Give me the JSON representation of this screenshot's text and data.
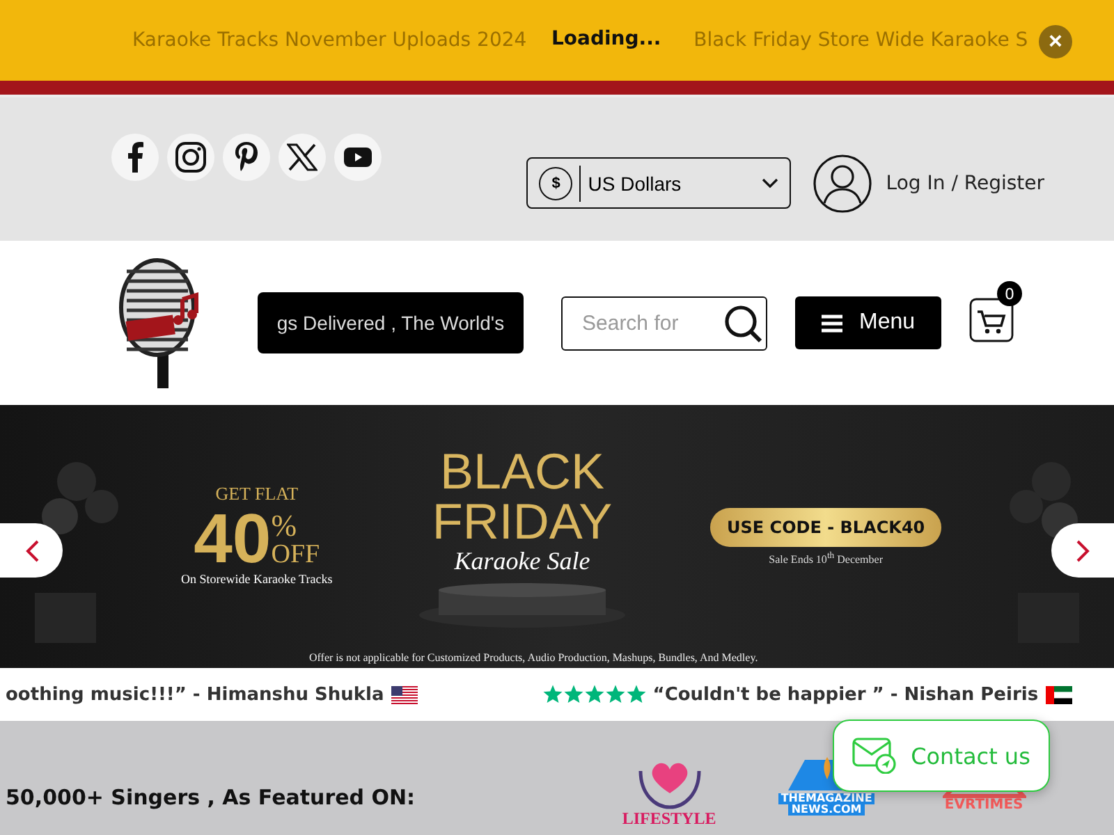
{
  "announcement_bar": {
    "items": [
      "Karaoke Tracks November Uploads 2024",
      "Black Friday Store Wide Karaoke S"
    ],
    "status": "Loading...",
    "close_label": "×"
  },
  "top_header": {
    "social_links": [
      {
        "kind": "facebook"
      },
      {
        "kind": "instagram"
      },
      {
        "kind": "pinterest"
      },
      {
        "kind": "x"
      },
      {
        "kind": "youtube"
      }
    ],
    "currency": {
      "symbol": "$",
      "value": "US Dollars"
    },
    "account_link": "Log In / Register"
  },
  "nav": {
    "tagline_marquee": "gs Delivered , The World's",
    "search": {
      "placeholder": "Search for"
    },
    "menu_button": "Menu",
    "cart_count": "0"
  },
  "banner": {
    "offer_top": "GET FLAT",
    "offer_percent": "40",
    "offer_symbol": "%",
    "offer_off": "OFF",
    "offer_note": "On Storewide Karaoke Tracks",
    "title_line_1": "BLACK",
    "title_line_2": "FRIDAY",
    "subtitle": "Karaoke Sale",
    "code": "USE CODE - BLACK40",
    "sale_ends": "Sale Ends 10$^{th}$ December",
    "disclaimer": "Offer is not applicable for Customized Products, Audio Production, Mashups, Bundles, And Medley."
  },
  "reviews": [
    {
      "text": "oothing music!!!” - Himanshu Shukla",
      "kind": "us"
    },
    {
      "text": "“Couldn't be happier ” - Nishan Peiris",
      "stars": 5,
      "kind": "ae"
    }
  ],
  "featured": {
    "heading": "50,000+ Singers , As Featured ON:",
    "logos": [
      {
        "kind": "lifestyle",
        "lines": [
          "LIFESTYLE"
        ]
      },
      {
        "kind": "magazine",
        "lines": [
          "THEMAGAZINE",
          "NEWS.COM"
        ]
      },
      {
        "kind": "times",
        "lines": [
          "EVRTIMES"
        ]
      }
    ]
  },
  "contact_button": "Contact us"
}
